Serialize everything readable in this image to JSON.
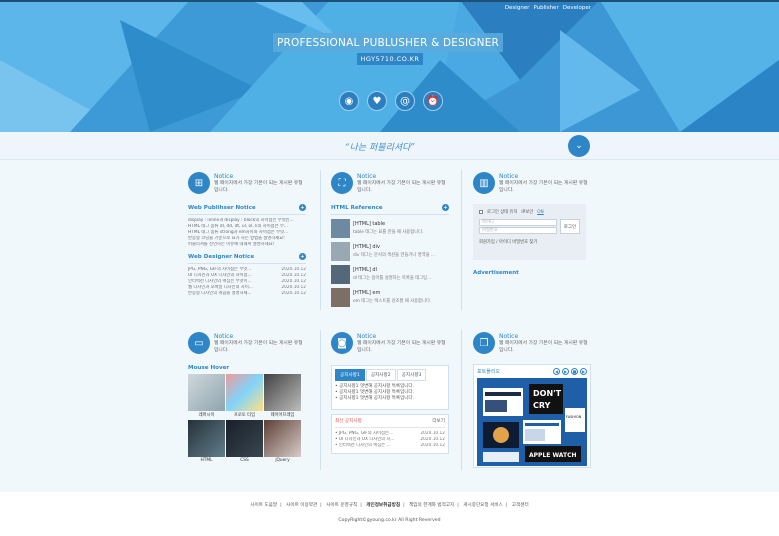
{
  "header": {
    "nav": [
      "Designer",
      "Publisher",
      "Developer"
    ],
    "title": "PROFESSIONAL PUBLUSHER & DESIGNER",
    "url": "HGY5710.CO.KR",
    "icons": [
      "record-icon",
      "heart-icon",
      "at-icon",
      "alarm-icon"
    ]
  },
  "slogan": "“나는 퍼블리셔다”",
  "notices": [
    {
      "title": "Notice",
      "desc": "웹 페이지에서 가장 기본이 되는 게시판 유형입니다."
    },
    {
      "title": "Notice",
      "desc": "웹 페이지에서 가장 기본이 되는 게시판 유형입니다."
    },
    {
      "title": "Notice",
      "desc": "웹 페이지에서 가장 기본이 되는 게시판 유형입니다."
    },
    {
      "title": "Notice",
      "desc": "웹 페이지에서 가장 기본이 되는 게시판 유형입니다."
    },
    {
      "title": "Notice",
      "desc": "웹 페이지에서 가장 기본이 되는 게시판 유형입니다."
    },
    {
      "title": "Notice",
      "desc": "웹 페이지에서 가장 기본이 되는 게시판 유형입니다."
    }
  ],
  "publisher_notice": {
    "title": "Web Publihser Notice",
    "items": [
      "display : inline과 display : block의 차이점은 무엇인...",
      "HTML 태그 종류 dl, dd, dt, ul, ol, li의 차이점은 무...",
      "HTML 태그 종류 strong과 em차이와 차이점은 무엇...",
      "반응형 코딩을 기준으로 요가 하는 방법을 설명하세요!",
      "퍼블리셔를 선언하는 이유에 대해서 설명하세요!"
    ]
  },
  "designer_notice": {
    "title": "Web Designer Notice",
    "items": [
      {
        "text": "JPG, PNG, GIF의 차이점은 무엇...",
        "date": "2020.10.12"
      },
      {
        "text": "UI 디자인과 UX 디자인의 차이점...",
        "date": "2020.10.12"
      },
      {
        "text": "인터렉션 디자인의 핵심은 무엇이...",
        "date": "2020.10.12"
      },
      {
        "text": "웹 디자인과 모바일 디자인의 차이...",
        "date": "2020.10.12"
      },
      {
        "text": "반응형 디자인의 개념을 설명하세...",
        "date": "2020.10.12"
      }
    ]
  },
  "html_reference": {
    "title": "HTML Reference",
    "items": [
      {
        "tag": "[HTML] table",
        "desc": "table 태그는 표를 만들 때 사용합니다."
      },
      {
        "tag": "[HTML] div",
        "desc": "div 태그는 문서의 섹션을 만들거나 영역을 ..."
      },
      {
        "tag": "[HTML] dl",
        "desc": "dl 태그는 용어를 설명하는 목록을 태그입..."
      },
      {
        "tag": "[HTML] em",
        "desc": "em 태그는 텍스트를 강조할 때 사용합니다."
      }
    ]
  },
  "login": {
    "keep_label": "로그인 상태 유지",
    "ip_label": "IP보안",
    "ip_state": "ON",
    "id_placeholder": "아이디",
    "pw_placeholder": "비밀번호",
    "button": "로그인",
    "links": "회원가입 / 아이디 비밀번호 찾기"
  },
  "advertisement": "Advertisement",
  "mouse_hover": {
    "title": "Mouse Hover",
    "items": [
      "레퍼시이",
      "프로토 타입",
      "웨어어프레임",
      "HTML",
      "CSS",
      "jQuery"
    ]
  },
  "tabs": {
    "labels": [
      "공지사항1",
      "공지사항2",
      "공지사항3"
    ],
    "items": [
      "공지사항1 멋변해 공지사항 특록입니다.",
      "공지사항1 멋변해 공지사항 특록입니다.",
      "공지사항1 멋변해 공지사항 특록입니다."
    ]
  },
  "latest": {
    "title": "최신 공지사항",
    "more": "더보기",
    "items": [
      {
        "text": "JPG, PNG, GIF의 차이점은...",
        "date": "2020.10.12"
      },
      {
        "text": "UI 디자인과 UX 디자인의 차...",
        "date": "2020.10.12"
      },
      {
        "text": "인터렉션 디자인의 핵심은 ...",
        "date": "2020.10.12"
      }
    ]
  },
  "portfolio": {
    "title": "포트폴리오",
    "controls": [
      "◀",
      "▶",
      "■",
      "▶"
    ]
  },
  "footer": {
    "links": [
      "사이트 도움말",
      "사이트 이용약관",
      "사이트 운영규칙",
      "개인정보취급방침",
      "책임의 한계와 법적고지",
      "게시중단요청 서비스",
      "고객센터"
    ],
    "bold_index": 3,
    "copyright": "CopyRight©gyoung.co.kr All Right Reverved"
  },
  "colors": {
    "accent": "#2f86c6",
    "hero": "#4aa8e0",
    "panel": "#f1f8fc"
  }
}
